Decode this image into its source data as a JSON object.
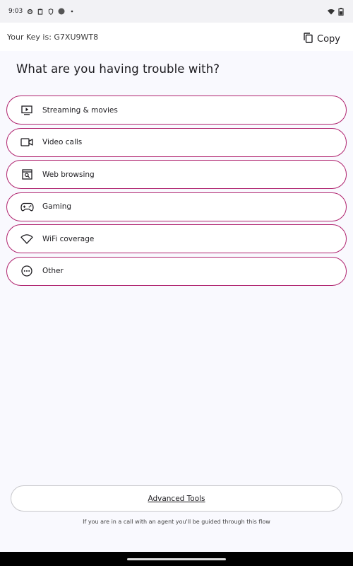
{
  "status_bar": {
    "time": "9:03",
    "left_icons": [
      "gear-icon",
      "clipboard-icon",
      "shield-icon",
      "circle-icon",
      "dot-icon"
    ],
    "right_icons": [
      "wifi-icon",
      "battery-icon"
    ]
  },
  "key_bar": {
    "key_text": "Your Key is: G7XU9WT8",
    "copy_label": "Copy"
  },
  "title": "What are you having trouble with?",
  "options": [
    {
      "label": "Streaming & movies",
      "icon": "tv-play-icon"
    },
    {
      "label": "Video calls",
      "icon": "video-camera-icon"
    },
    {
      "label": "Web browsing",
      "icon": "browser-search-icon"
    },
    {
      "label": "Gaming",
      "icon": "gamepad-icon"
    },
    {
      "label": "WiFi coverage",
      "icon": "wifi-icon"
    },
    {
      "label": "Other",
      "icon": "more-horizontal-icon"
    }
  ],
  "advanced_tools_label": "Advanced Tools",
  "footer_note": "If you are in a call with an agent you'll be guided through this flow",
  "colors": {
    "accent": "#b0246f",
    "background": "#f9f9fe"
  }
}
